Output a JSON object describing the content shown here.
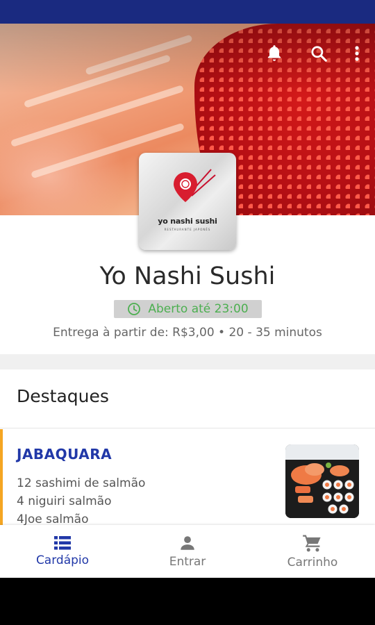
{
  "restaurant": {
    "name": "Yo Nashi Sushi",
    "logo_text": "yo nashi sushi",
    "logo_subtext": "RESTAURANTE JAPONÊS",
    "status": "Aberto até 23:00",
    "delivery_info": "Entrega à partir de: R$3,00 • 20 - 35 minutos"
  },
  "header_icons": [
    "bell-icon",
    "search-icon",
    "more-vertical-icon"
  ],
  "section": {
    "title": "Destaques"
  },
  "products": [
    {
      "name": "JABAQUARA",
      "lines": [
        "12 sashimi de salmão",
        "4 niguiri salmão",
        "4Joe salmão"
      ]
    }
  ],
  "bottom_nav": {
    "items": [
      {
        "label": "Cardápio",
        "icon": "menu-list-icon",
        "active": true
      },
      {
        "label": "Entrar",
        "icon": "person-icon",
        "active": false
      },
      {
        "label": "Carrinho",
        "icon": "cart-icon",
        "active": false
      }
    ]
  },
  "colors": {
    "status_bar": "#1a2a80",
    "primary": "#2138a8",
    "accent": "#f5a623",
    "open_green": "#4caf50"
  }
}
